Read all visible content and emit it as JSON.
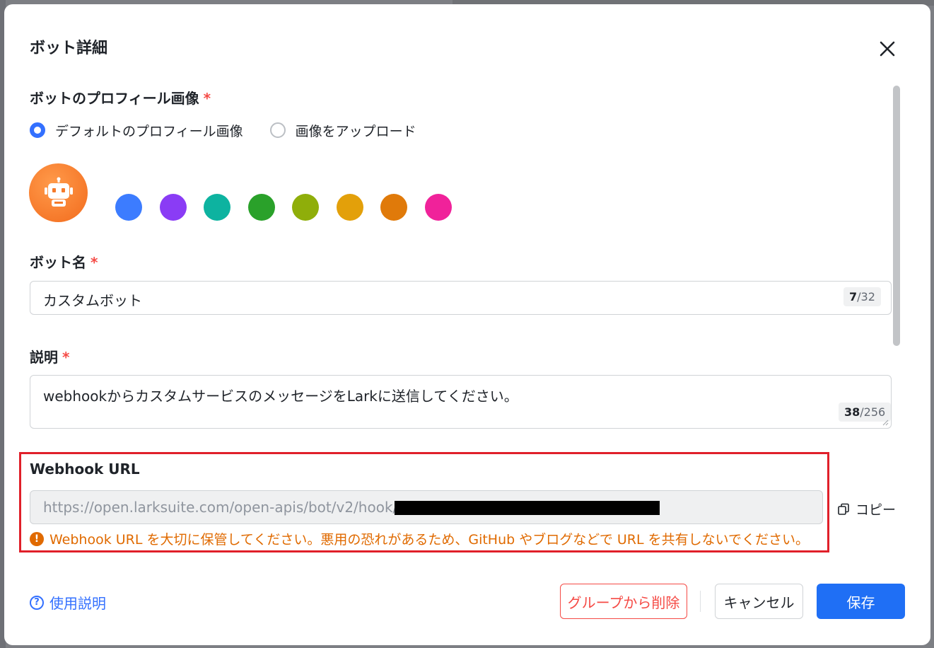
{
  "dialog": {
    "title": "ボット詳細"
  },
  "profile_image": {
    "label": "ボットのプロフィール画像",
    "required_mark": "*",
    "options": [
      {
        "label": "デフォルトのプロフィール画像",
        "checked": true
      },
      {
        "label": "画像をアップロード",
        "checked": false
      }
    ],
    "avatar_icon": "robot-icon",
    "avatar_color": "#f57a2a",
    "swatches": [
      "#3c7cff",
      "#8a3cf5",
      "#0db3a0",
      "#2aa12a",
      "#8fae0a",
      "#e3a00a",
      "#e07a0a",
      "#f0229a"
    ]
  },
  "bot_name": {
    "label": "ボット名",
    "required_mark": "*",
    "value": "カスタムボット",
    "count": "7",
    "max": "/32"
  },
  "description": {
    "label": "説明",
    "required_mark": "*",
    "value": "webhookからカスタムサービスのメッセージをLarkに送信してください。",
    "count": "38",
    "max": "/256"
  },
  "webhook": {
    "label": "Webhook URL",
    "url_prefix": "https://open.larksuite.com/open-apis/bot/v2/hook/",
    "copy_label": "コピー",
    "warning_icon": "!",
    "warning": "Webhook URL を大切に保管してください。悪用の恐れがあるため、GitHub やブログなどで URL を共有しないでください。"
  },
  "footer": {
    "help_icon": "?",
    "help_label": "使用説明",
    "remove_label": "グループから削除",
    "cancel_label": "キャンセル",
    "save_label": "保存"
  },
  "colors": {
    "primary": "#1f6ff5",
    "danger": "#f54a45",
    "warning": "#e06a00",
    "highlight": "#e0202a"
  }
}
